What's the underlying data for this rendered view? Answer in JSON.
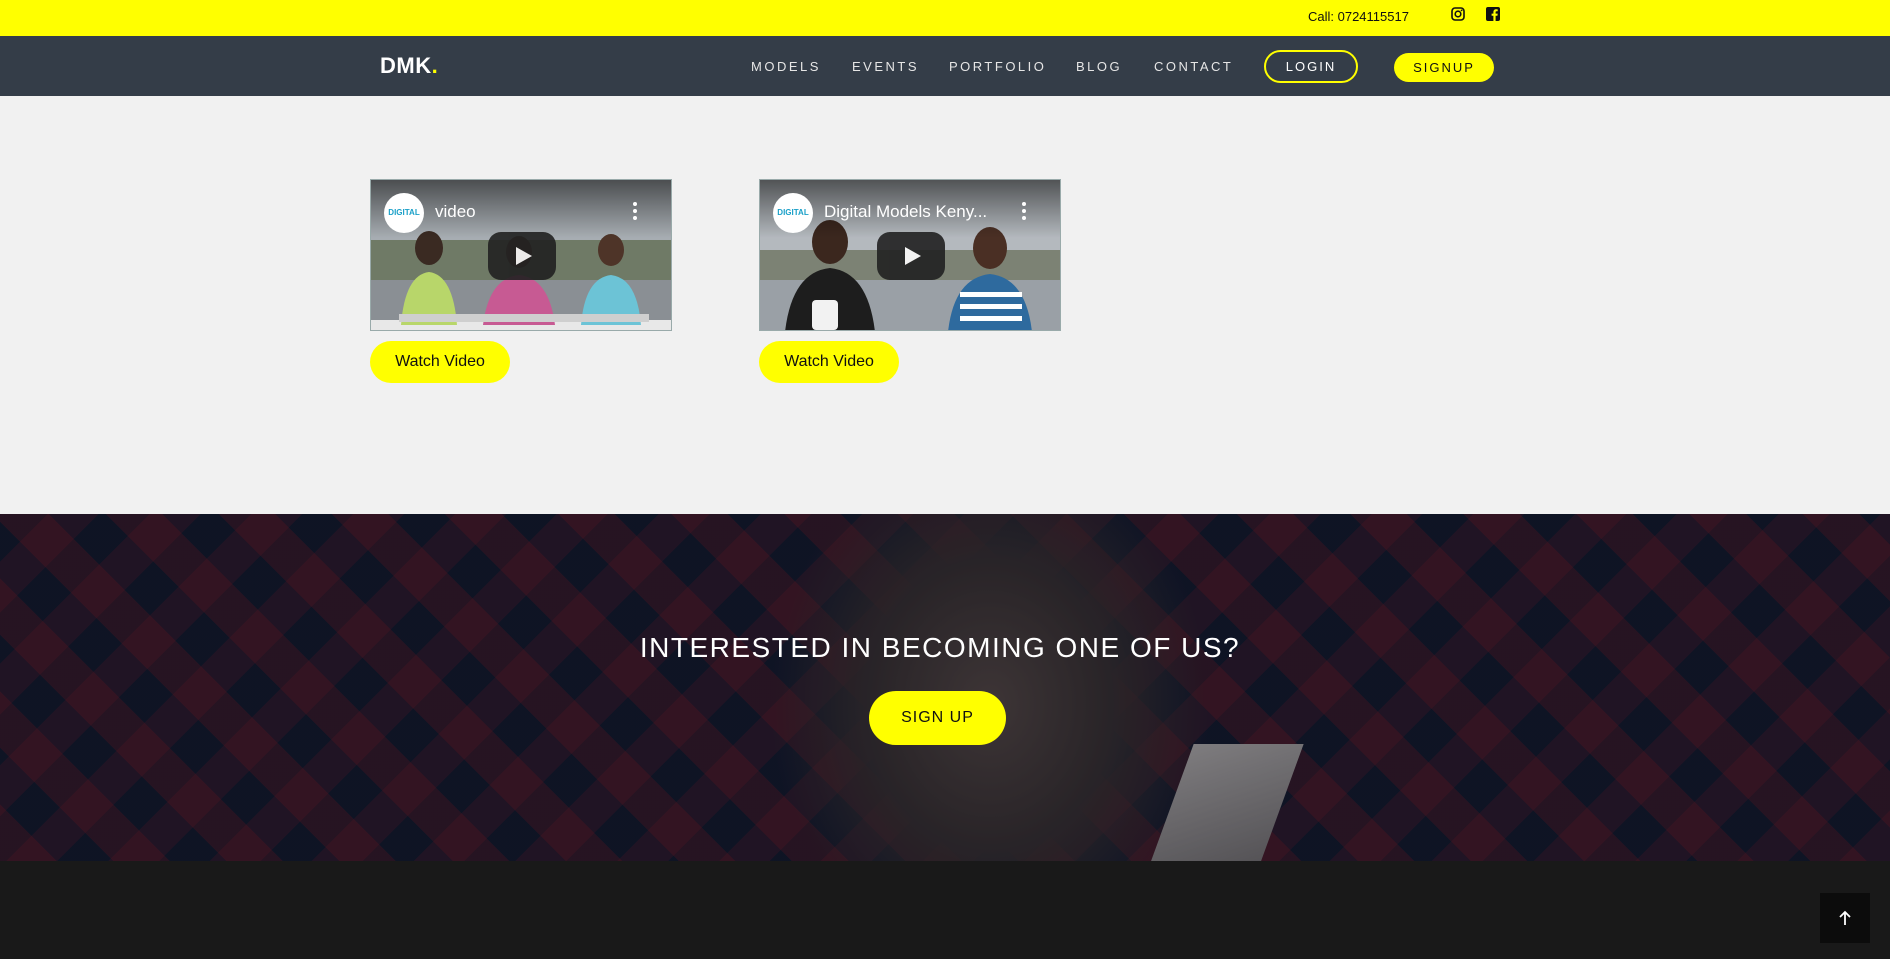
{
  "topbar": {
    "call": "Call: 0724115517",
    "icons": [
      "instagram-icon",
      "facebook-icon"
    ],
    "background": "#ffff00"
  },
  "nav": {
    "logo": "DMK",
    "logo_dot": ".",
    "links": [
      "MODELS",
      "EVENTS",
      "PORTFOLIO",
      "BLOG",
      "CONTACT"
    ],
    "login": "LOGIN",
    "signup": "SIGNUP"
  },
  "videos": [
    {
      "title": "video",
      "channel_logo": "DIGITAL",
      "button": "Watch Video"
    },
    {
      "title": "Digital Models Keny...",
      "channel_logo": "DIGITAL",
      "button": "Watch Video"
    }
  ],
  "banner": {
    "heading": "INTERESTED IN BECOMING ONE OF US?",
    "button": "SIGN UP"
  },
  "colors": {
    "accent": "#ffff00",
    "nav_bg": "#343d48",
    "page_bg": "#f1f1f1",
    "footer_bg": "#191919"
  }
}
